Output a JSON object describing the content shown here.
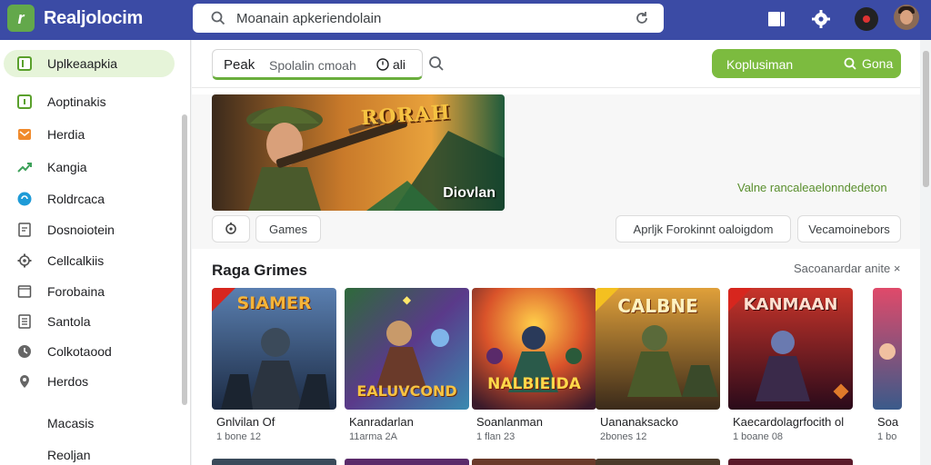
{
  "app": {
    "title": "Realjolocim",
    "logo_glyph": "r"
  },
  "search": {
    "value": "Moanain apkeriendolain"
  },
  "sidebar": {
    "items": [
      {
        "label": "Uplkeaapkia",
        "icon": "app-tile-icon",
        "active": true
      },
      {
        "label": "Aoptinakis",
        "icon": "square-icon"
      },
      {
        "label": "Herdia",
        "icon": "mail-icon"
      },
      {
        "label": "Kangia",
        "icon": "trend-icon"
      },
      {
        "label": "Roldrcaca",
        "icon": "chat-icon"
      },
      {
        "label": "Dosnoiotein",
        "icon": "doc-icon"
      },
      {
        "label": "Cellcalkiis",
        "icon": "gear-outline-icon"
      },
      {
        "label": "Forobaina",
        "icon": "folder-icon"
      },
      {
        "label": "Santola",
        "icon": "list-icon"
      },
      {
        "label": "Colkotaood",
        "icon": "clock-icon"
      },
      {
        "label": "Herdos",
        "icon": "pin-icon"
      }
    ],
    "extra": [
      "Macasis",
      "Reoljan"
    ]
  },
  "filters": {
    "first": "Peak",
    "second": "Spolalin cmoah",
    "third": "ali"
  },
  "green_button": {
    "left": "Koplusiman",
    "right": "Gona"
  },
  "banner": {
    "title": "RORAH",
    "subtitle": "Diovlan"
  },
  "promo_link": "Valne rancaleaelonndedeton",
  "chips": [
    "Games",
    "Aprljk Forokinnt oaloigdom",
    "Vecamoinebors"
  ],
  "section": {
    "title": "Raga Grimes",
    "link": "Sacoanardar anite ×"
  },
  "cards": [
    {
      "art_text": "SIAMER",
      "title": "Gnlvilan Of",
      "sub": "1 bone 12"
    },
    {
      "art_text": "EALUVCOND",
      "title": "Kanradarlan",
      "sub": "11arma 2A"
    },
    {
      "art_text": "NALBIEIDA",
      "title": "Soanlanman",
      "sub": "1 flan 23"
    },
    {
      "art_text": "CALBNE",
      "title": "Uananaksacko",
      "sub": "2bones 12"
    },
    {
      "art_text": "KANMAAN",
      "title": "Kaecardolagrfocith ol",
      "sub": "1 boane 08"
    },
    {
      "art_text": "",
      "title": "Soa",
      "sub": "1 bo"
    }
  ],
  "colors": {
    "topbar": "#3b4ba5",
    "accent_green": "#7cbb3f",
    "active_bg": "#e6f4d9"
  }
}
